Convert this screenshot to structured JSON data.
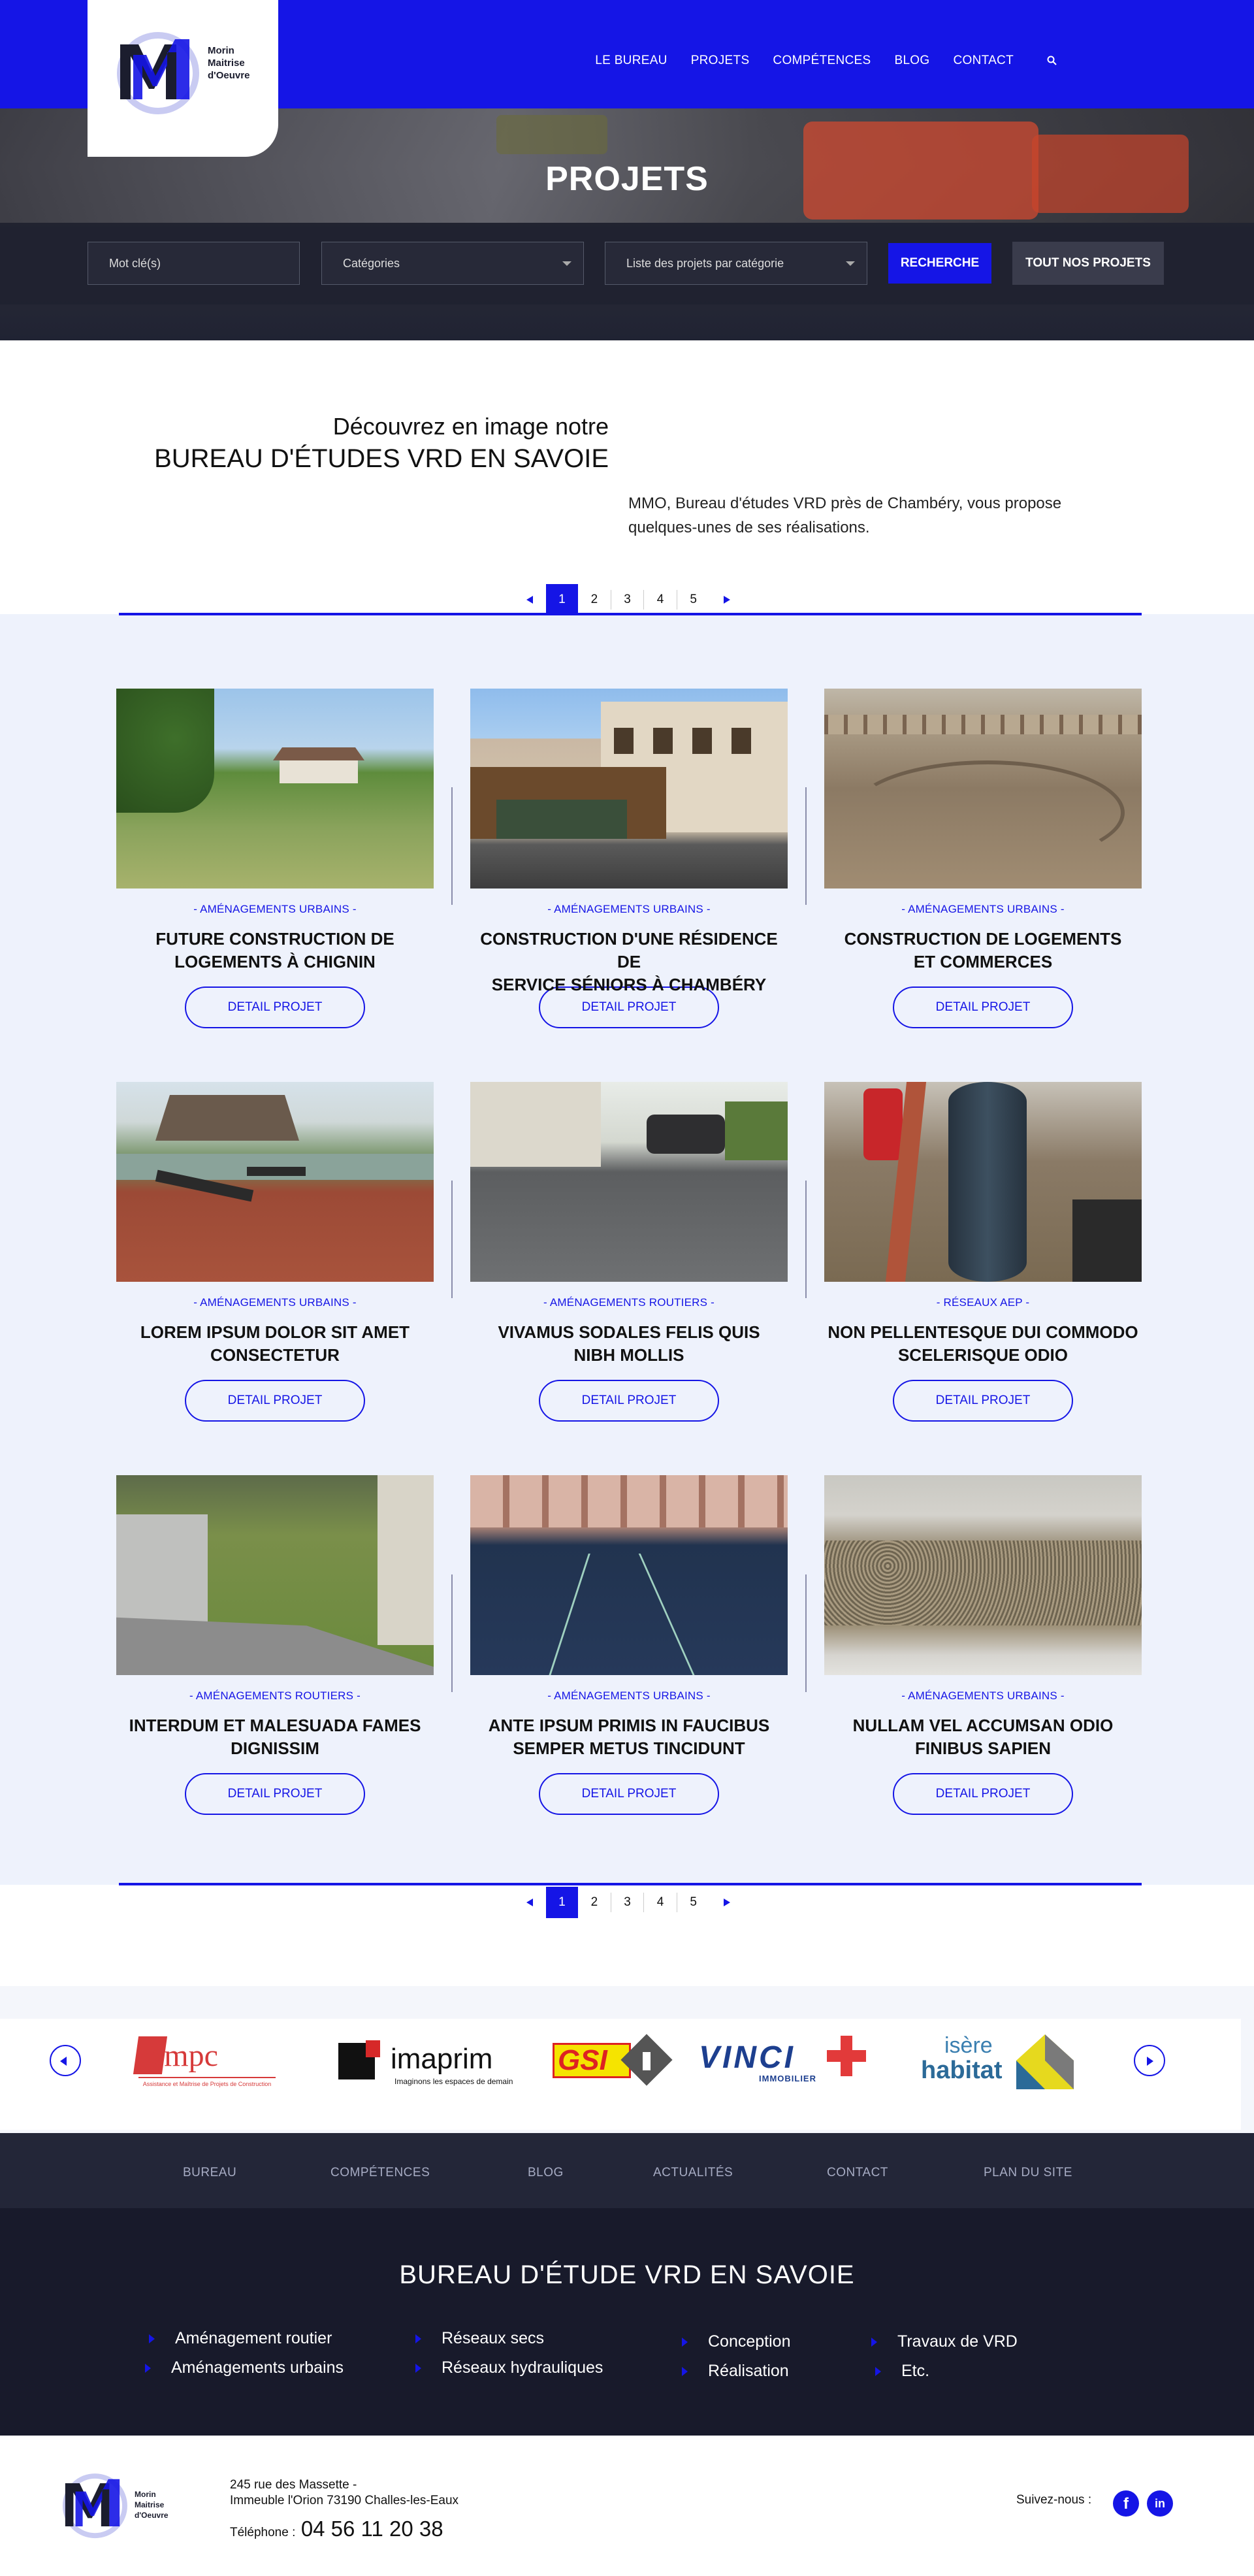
{
  "brand": {
    "logo_lines": [
      "Morin",
      "Maitrise",
      "d'Oeuvre"
    ],
    "accent": "#1515e6",
    "dark": "#181a2b"
  },
  "nav": {
    "items": [
      "LE BUREAU",
      "PROJETS",
      "COMPÉTENCES",
      "BLOG",
      "CONTACT"
    ],
    "search_icon": "search-icon"
  },
  "hero": {
    "title": "PROJETS",
    "search": {
      "keyword_placeholder": "Mot clé(s)",
      "category_select": "Catégories",
      "list_select": "Liste des projets par catégorie",
      "search_button": "RECHERCHE",
      "all_button": "TOUT NOS PROJETS"
    }
  },
  "intro": {
    "line1": "Découvrez en image notre",
    "line2": "BUREAU D'ÉTUDES VRD EN SAVOIE",
    "text": "MMO, Bureau d'études VRD près de Chambéry, vous propose quelques-unes de ses réalisations."
  },
  "pagination": {
    "pages": [
      "1",
      "2",
      "3",
      "4",
      "5"
    ],
    "active": "1"
  },
  "projects": [
    {
      "category": "- AMÉNAGEMENTS URBAINS -",
      "title_l1": "FUTURE CONSTRUCTION DE",
      "title_l2": "LOGEMENTS À CHIGNIN",
      "button": "DETAIL PROJET",
      "image": "grass-field-photo"
    },
    {
      "category": "- AMÉNAGEMENTS URBAINS -",
      "title_l1": "CONSTRUCTION D'UNE RÉSIDENCE DE",
      "title_l2": "SERVICE SÉNIORS À CHAMBÉRY",
      "button": "DETAIL PROJET",
      "image": "residence-building-photo"
    },
    {
      "category": "- AMÉNAGEMENTS URBAINS -",
      "title_l1": "CONSTRUCTION DE LOGEMENTS",
      "title_l2": "ET COMMERCES",
      "button": "DETAIL PROJET",
      "image": "earthworks-photo"
    },
    {
      "category": "- AMÉNAGEMENTS URBAINS -",
      "title_l1": "LOREM IPSUM DOLOR SIT AMET",
      "title_l2": "CONSECTETUR",
      "button": "DETAIL PROJET",
      "image": "park-bench-photo"
    },
    {
      "category": "- AMÉNAGEMENTS ROUTIERS -",
      "title_l1": "VIVAMUS SODALES FELIS QUIS",
      "title_l2": "NIBH MOLLIS",
      "button": "DETAIL PROJET",
      "image": "parking-lot-photo"
    },
    {
      "category": "- RÉSEAUX AEP -",
      "title_l1": "NON PELLENTESQUE DUI COMMODO",
      "title_l2": "SCELERISQUE ODIO",
      "button": "DETAIL PROJET",
      "image": "pipe-trench-photo"
    },
    {
      "category": "- AMÉNAGEMENTS ROUTIERS -",
      "title_l1": "INTERDUM ET MALESUADA FAMES",
      "title_l2": "DIGNISSIM",
      "button": "DETAIL PROJET",
      "image": "pathway-photo"
    },
    {
      "category": "- AMÉNAGEMENTS URBAINS -",
      "title_l1": "ANTE IPSUM PRIMIS IN FAUCIBUS",
      "title_l2": "SEMPER METUS TINCIDUNT",
      "button": "DETAIL PROJET",
      "image": "blue-track-photo"
    },
    {
      "category": "- AMÉNAGEMENTS URBAINS -",
      "title_l1": "NULLAM VEL ACCUMSAN ODIO",
      "title_l2": "FINIBUS SAPIEN",
      "button": "DETAIL PROJET",
      "image": "gravel-photo"
    }
  ],
  "partners": {
    "logos": [
      {
        "name": "cmpc",
        "main": "cmpc",
        "sub": "Assistance et Maîtrise de Projets de Construction"
      },
      {
        "name": "imaprim",
        "main": "imaprim",
        "sub": "Imaginons les espaces de demain"
      },
      {
        "name": "gsi",
        "main": "GSI"
      },
      {
        "name": "vinci-immobilier",
        "main": "VINCI",
        "sub": "IMMOBILIER"
      },
      {
        "name": "isere-habitat",
        "main1": "isère",
        "main2": "habitat"
      }
    ]
  },
  "footer_nav": [
    "BUREAU",
    "COMPÉTENCES",
    "BLOG",
    "ACTUALITÉS",
    "CONTACT",
    "PLAN DU SITE"
  ],
  "footer": {
    "heading": "BUREAU D'ÉTUDE VRD EN SAVOIE",
    "col1": [
      "Aménagement routier",
      "Aménagements urbains"
    ],
    "col2": [
      "Réseaux secs",
      "Réseaux hydrauliques"
    ],
    "col3": [
      "Conception",
      "Réalisation"
    ],
    "col4": [
      "Travaux de VRD",
      "Etc."
    ]
  },
  "contact": {
    "address_l1": "245 rue des Massette -",
    "address_l2": "Immeuble l'Orion 73190 Challes-les-Eaux",
    "phone_label": "Téléphone :",
    "phone": "04 56 11 20 38",
    "follow": "Suivez-nous :",
    "facebook": "f",
    "linkedin": "in"
  }
}
